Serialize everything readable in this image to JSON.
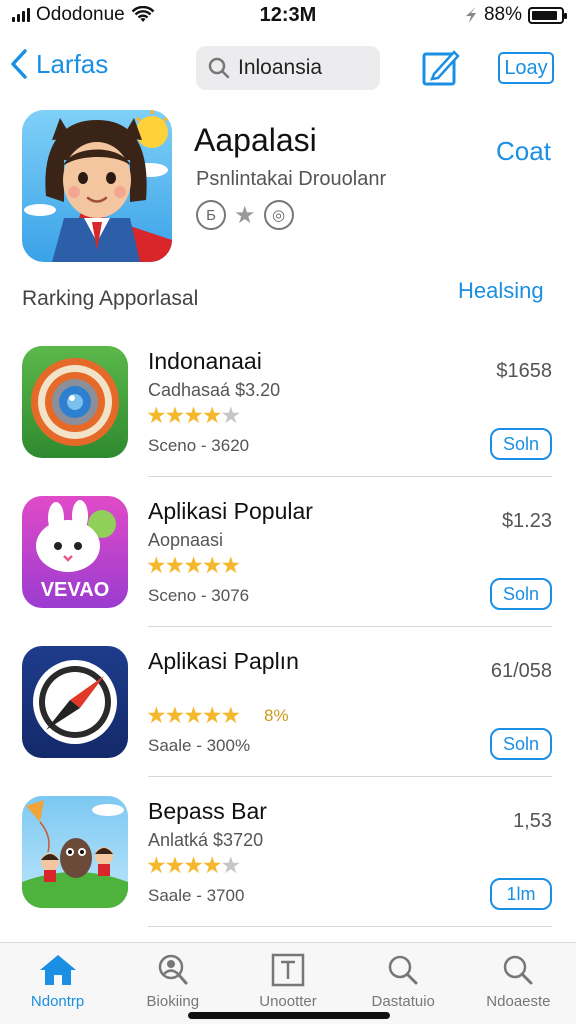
{
  "status": {
    "carrier": "Ododonue",
    "time": "12:3M",
    "battery": "88%",
    "battery_level": 0.88
  },
  "nav": {
    "back_label": "Larfas",
    "search_value": "Inloansia",
    "done_label": "Loay"
  },
  "featured": {
    "name": "Aapalasi",
    "subtitle": "Psnlintakai Drouolanr",
    "badge_letter": "Б",
    "get_label": "Coat"
  },
  "section": {
    "title": "Rarking Apporlasal",
    "link": "Healsing"
  },
  "apps": [
    {
      "name": "Indonanaai",
      "subtitle": "Cadhasaá $3.20",
      "rating": 4,
      "extra": "",
      "meta": "Sceno - 3620",
      "price": "$1658",
      "button": "Soln"
    },
    {
      "name": "Aplikasi Popular",
      "subtitle": "Aopnaasi",
      "rating": 5,
      "extra": "",
      "meta": "Sceno - 3076",
      "price": "$1.23",
      "button": "Soln"
    },
    {
      "name": "Aplikasi Paplın",
      "subtitle": "",
      "rating": 5,
      "extra": "8%",
      "meta": "Saale - 300%",
      "price": "61/058",
      "button": "Soln"
    },
    {
      "name": "Bepass Bar",
      "subtitle": "Anlatká $3720",
      "rating": 4,
      "extra": "",
      "meta": "Saale - 3700",
      "price": "1,53",
      "button": "1lm"
    }
  ],
  "tabs": [
    {
      "label": "Ndontrp",
      "icon": "home-icon",
      "active": true
    },
    {
      "label": "Biokiing",
      "icon": "search-person-icon",
      "active": false
    },
    {
      "label": "Unootter",
      "icon": "text-box-icon",
      "active": false
    },
    {
      "label": "Dastatuio",
      "icon": "search-icon",
      "active": false
    },
    {
      "label": "Ndoaeste",
      "icon": "search-icon",
      "active": false
    }
  ],
  "colors": {
    "accent": "#1a8fe3",
    "star": "#f5b72b"
  }
}
